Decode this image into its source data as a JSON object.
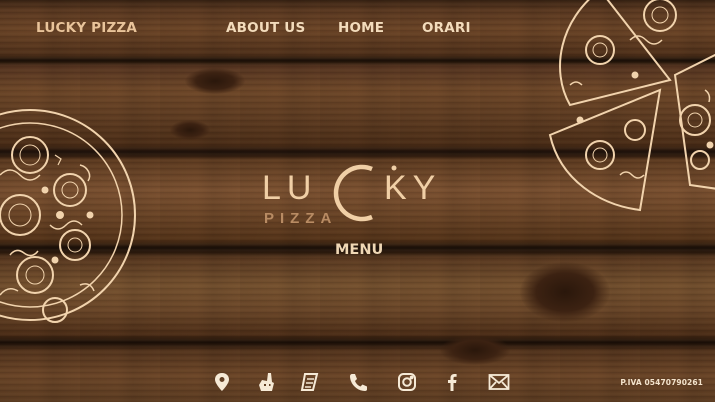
{
  "nav": {
    "brand": "LUCKY PIZZA",
    "about": "ABOUT US",
    "home": "HOME",
    "orari": "ORARI"
  },
  "logo": {
    "text": "LUCKY",
    "subtitle": "PIZZA"
  },
  "main": {
    "menu_label": "MENU"
  },
  "footer": {
    "icons": [
      "map-pin-icon",
      "deliveroo-icon",
      "justeat-icon",
      "phone-icon",
      "instagram-icon",
      "facebook-icon",
      "mail-icon"
    ],
    "piva": "P.IVA 05470790261"
  },
  "colors": {
    "accent": "#e9c49a",
    "text": "#f3dcbc",
    "wood": "#5a3820"
  }
}
